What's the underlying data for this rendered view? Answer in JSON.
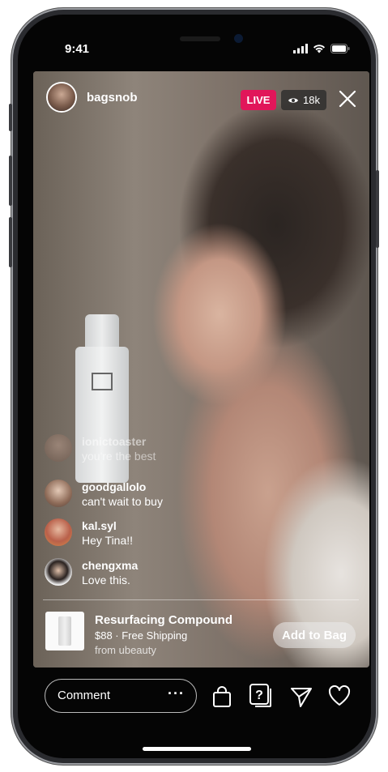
{
  "status_bar": {
    "time": "9:41"
  },
  "live": {
    "host_name": "bagsnob",
    "badge": "LIVE",
    "viewer_count": "18k"
  },
  "comments": [
    {
      "user": "ionictoaster",
      "text": "you're the best"
    },
    {
      "user": "goodgallolo",
      "text": "can't wait to buy"
    },
    {
      "user": "kal.syl",
      "text": "Hey Tina!!"
    },
    {
      "user": "chengxma",
      "text": "Love this."
    }
  ],
  "product": {
    "title": "Resurfacing Compound",
    "price_shipping": "$88 · Free Shipping",
    "seller": "from ubeauty",
    "cta": "Add to Bag"
  },
  "bottom_bar": {
    "comment_placeholder": "Comment",
    "more": "···"
  },
  "icons": [
    "eye-icon",
    "close-icon",
    "shopping-bag-icon",
    "question-sticker-icon",
    "send-icon",
    "heart-icon",
    "signal-icon",
    "wifi-icon",
    "battery-icon"
  ],
  "colors": {
    "live_badge": "#e1165a"
  }
}
